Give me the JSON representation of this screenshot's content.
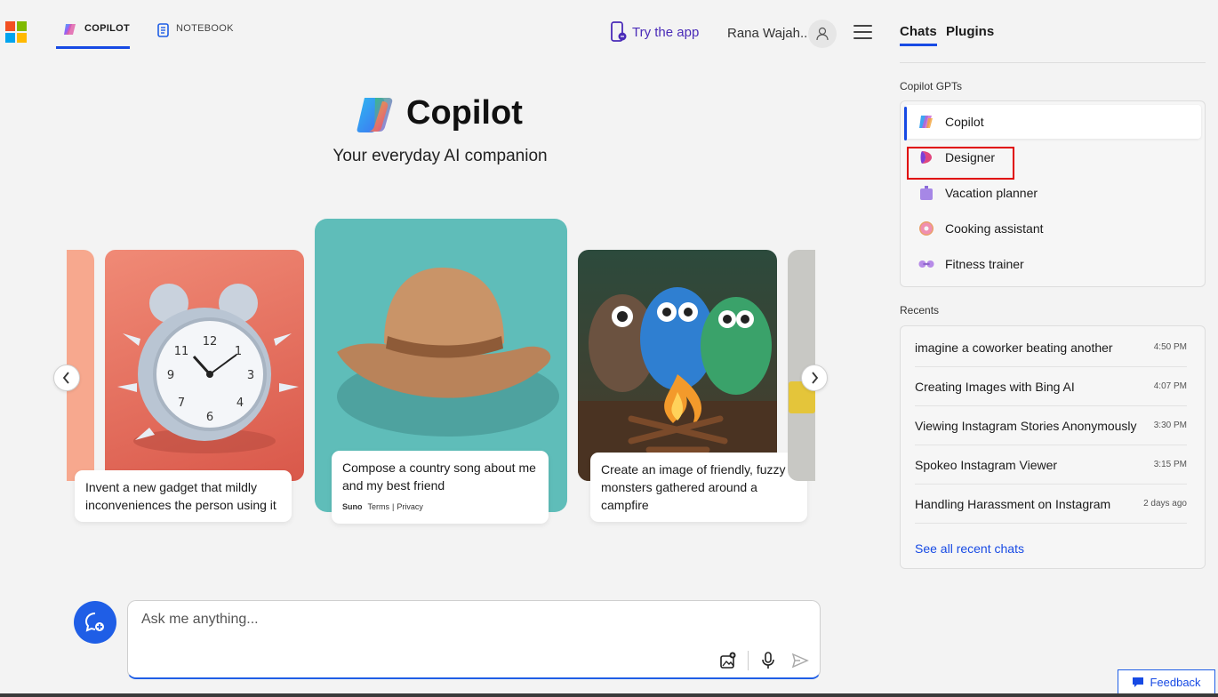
{
  "header": {
    "tabs": [
      {
        "label": "COPILOT",
        "active": true
      },
      {
        "label": "NOTEBOOK",
        "active": false
      }
    ],
    "try_app": "Try the app",
    "user_name": "Rana Wajah..."
  },
  "hero": {
    "title": "Copilot",
    "subtitle": "Your everyday AI companion"
  },
  "carousel": {
    "cards": [
      {
        "caption": "Invent a new gadget that mildly inconveniences the person using it",
        "image": "alarm-clock"
      },
      {
        "caption": "Compose a country song about me and my best friend",
        "image": "cowboy-hat",
        "meta": {
          "brand": "Suno",
          "terms": "Terms",
          "sep": "|",
          "privacy": "Privacy"
        }
      },
      {
        "caption": "Create an image of friendly, fuzzy monsters gathered around a campfire",
        "image": "fuzzy-monsters"
      }
    ]
  },
  "ask": {
    "placeholder": "Ask me anything..."
  },
  "right_panel": {
    "tabs": [
      {
        "label": "Chats",
        "active": true
      },
      {
        "label": "Plugins",
        "active": false
      }
    ],
    "gpts_heading": "Copilot GPTs",
    "gpts": [
      {
        "label": "Copilot",
        "icon": "copilot-icon",
        "active": true
      },
      {
        "label": "Designer",
        "icon": "designer-icon",
        "active": false
      },
      {
        "label": "Vacation planner",
        "icon": "suitcase-icon",
        "active": false
      },
      {
        "label": "Cooking assistant",
        "icon": "donut-icon",
        "active": false
      },
      {
        "label": "Fitness trainer",
        "icon": "dumbbell-icon",
        "active": false
      }
    ],
    "recents_heading": "Recents",
    "recents": [
      {
        "title": "imagine a coworker beating another",
        "time": "4:50 PM"
      },
      {
        "title": "Creating Images with Bing AI",
        "time": "4:07 PM"
      },
      {
        "title": "Viewing Instagram Stories Anonymously",
        "time": "3:30 PM"
      },
      {
        "title": "Spokeo Instagram Viewer",
        "time": "3:15 PM"
      },
      {
        "title": "Handling Harassment on Instagram",
        "time": "2 days ago"
      }
    ],
    "see_all": "See all recent chats"
  },
  "feedback_label": "Feedback",
  "colors": {
    "accent": "#174ae4",
    "highlight": "#e00000"
  }
}
